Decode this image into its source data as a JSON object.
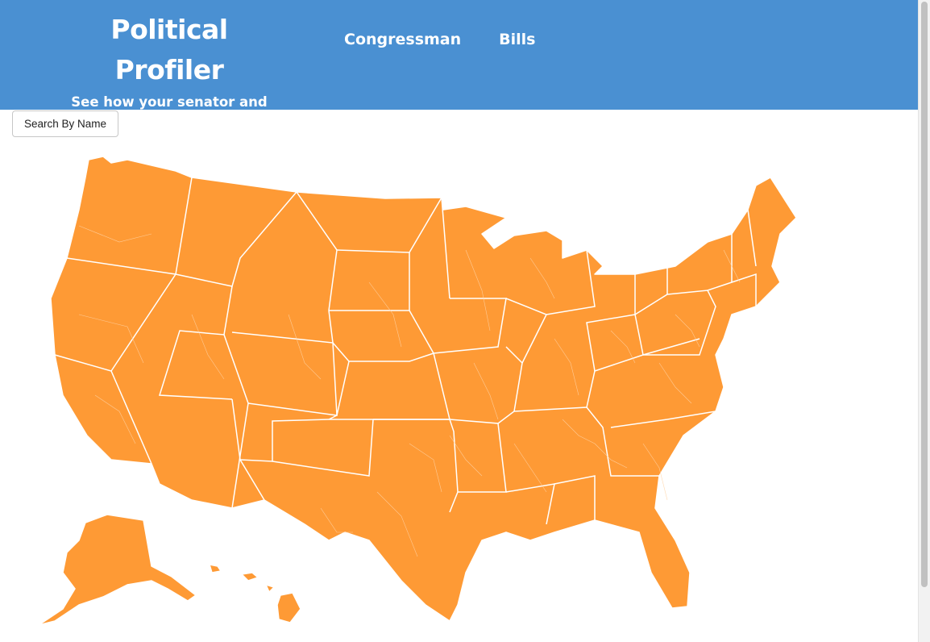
{
  "header": {
    "title": "Political Profiler",
    "subtitle": "See how your senator and representative voted on issues important to you!",
    "nav": [
      "Congressman",
      "Bills"
    ]
  },
  "search_button": {
    "label": "Search By Name"
  },
  "colors": {
    "header_bg": "#4a90d2",
    "map_fill": "#fe9a35",
    "map_border": "#ffffff"
  }
}
